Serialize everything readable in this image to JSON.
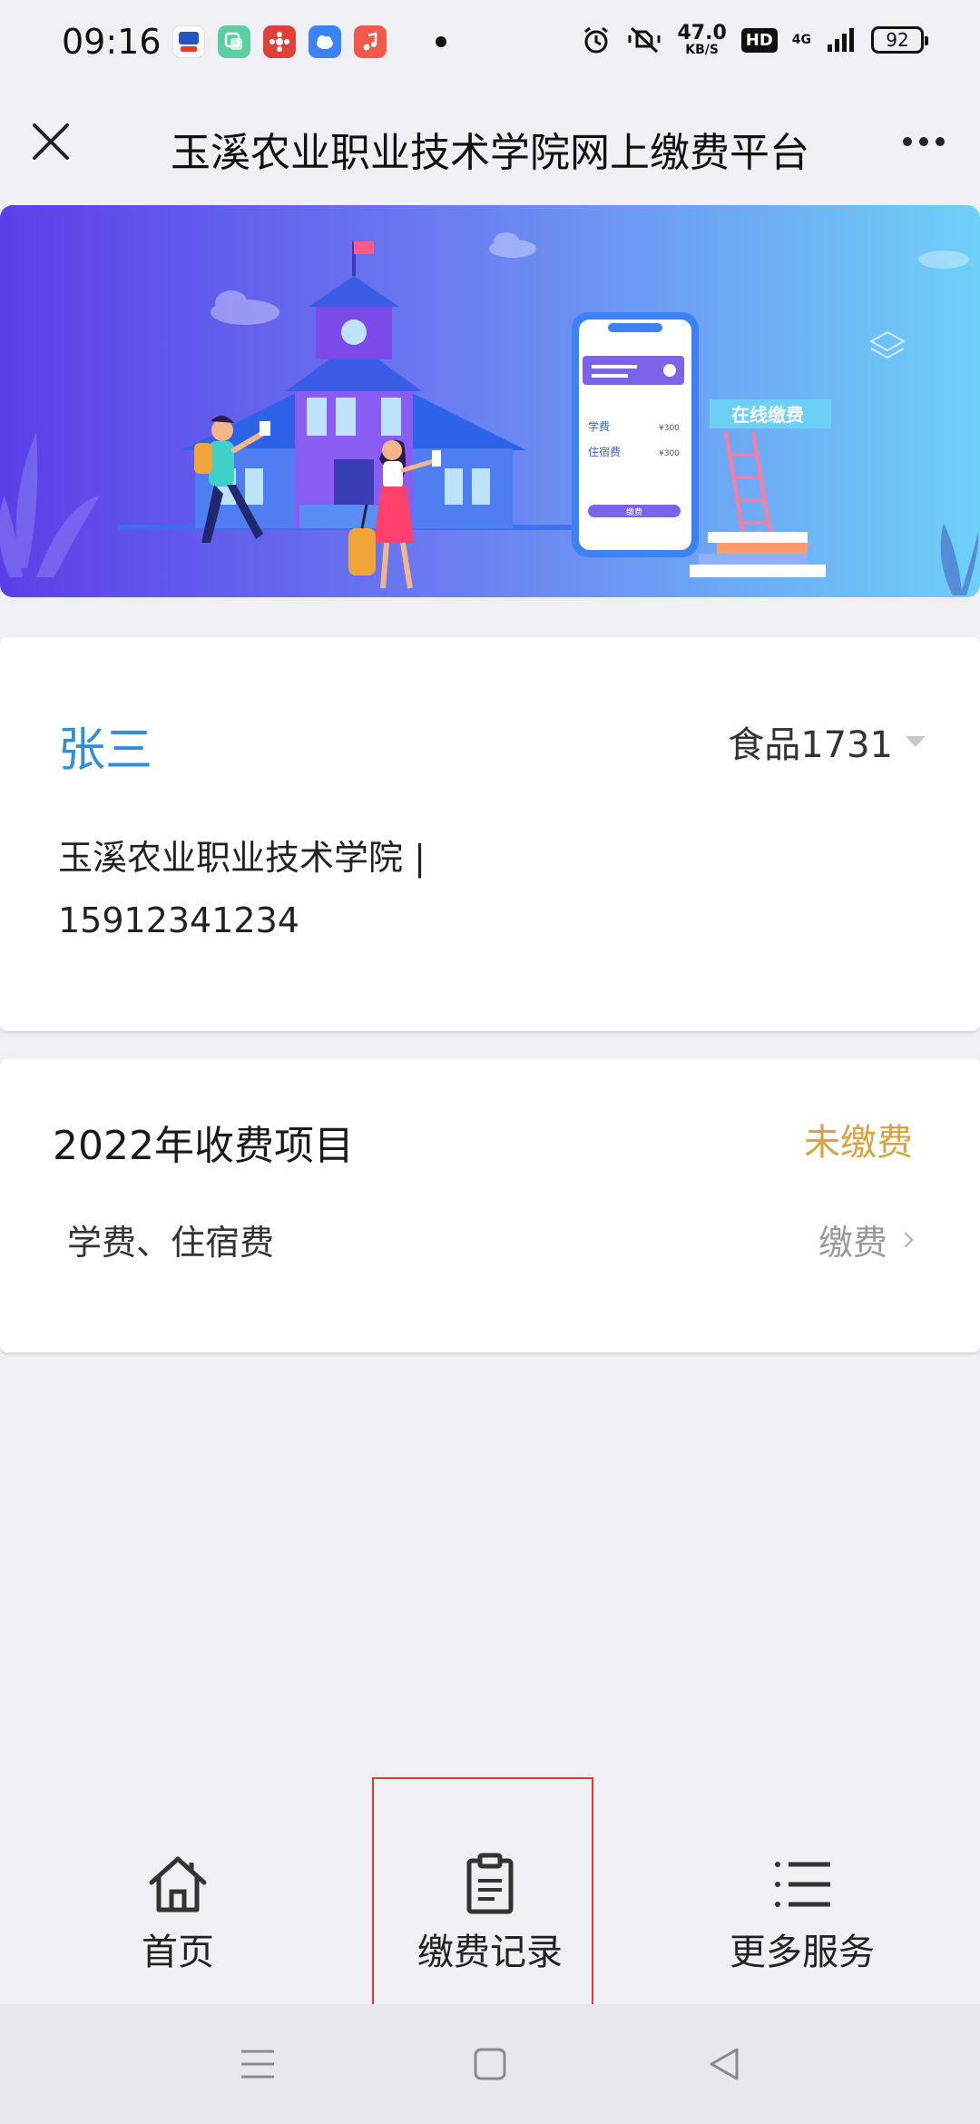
{
  "status_bar": {
    "time": "09:16",
    "network_speed_value": "47.0",
    "network_speed_unit": "KB/S",
    "hd_label": "HD",
    "network_type": "4G",
    "battery": "92"
  },
  "header": {
    "title": "玉溪农业职业技术学院网上缴费平台"
  },
  "banner": {
    "phone_items": [
      "学费",
      "住宿费"
    ],
    "phone_amount": "¥300",
    "phone_button": "缴费",
    "slogan": "在线缴费"
  },
  "student": {
    "name": "张三",
    "class": "食品1731",
    "school": "玉溪农业职业技术学院 |",
    "phone": "15912341234"
  },
  "fee": {
    "title": "2022年收费项目",
    "status": "未缴费",
    "items": "学费、住宿费",
    "action": "缴费"
  },
  "tabs": [
    {
      "label": "首页",
      "icon": "home-icon"
    },
    {
      "label": "缴费记录",
      "icon": "clipboard-icon"
    },
    {
      "label": "更多服务",
      "icon": "list-icon"
    }
  ],
  "colors": {
    "accent": "#2f8fd7",
    "unpaid": "#dba33f",
    "highlight_box": "#e53935",
    "background": "#efeff4"
  }
}
